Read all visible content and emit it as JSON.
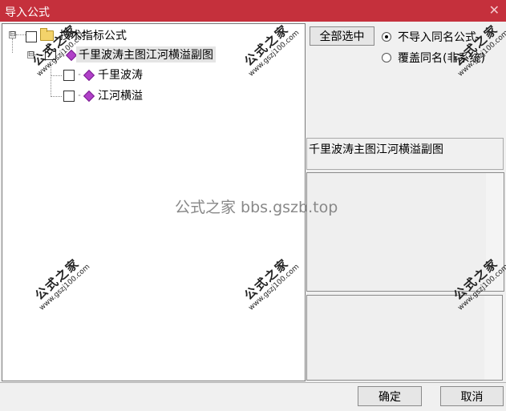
{
  "window": {
    "title": "导入公式",
    "close_glyph": "✕"
  },
  "tree": {
    "root": {
      "label": "技术指标公式",
      "expander": "⊟"
    },
    "group": {
      "label": "千里波涛主图江河横溢副图",
      "expander": "⊟"
    },
    "children": [
      {
        "label": "千里波涛"
      },
      {
        "label": "江河横溢"
      }
    ]
  },
  "right_panel": {
    "select_all_label": "全部选中",
    "options": [
      {
        "label": "不导入同名公式",
        "checked": true
      },
      {
        "label": "覆盖同名(非系统)",
        "checked": false
      }
    ],
    "formula_name": "千里波涛主图江河横溢副图"
  },
  "footer": {
    "ok_label": "确定",
    "cancel_label": "取消"
  },
  "overlays": {
    "center_watermark": "公式之家 bbs.gszb.top",
    "stamp_big": "公式之家",
    "stamp_small": "www.gszj100.com"
  },
  "colors": {
    "titlebar": "#c5303c",
    "gem_icon": "#b040c8",
    "folder_icon": "#f3d36b"
  }
}
